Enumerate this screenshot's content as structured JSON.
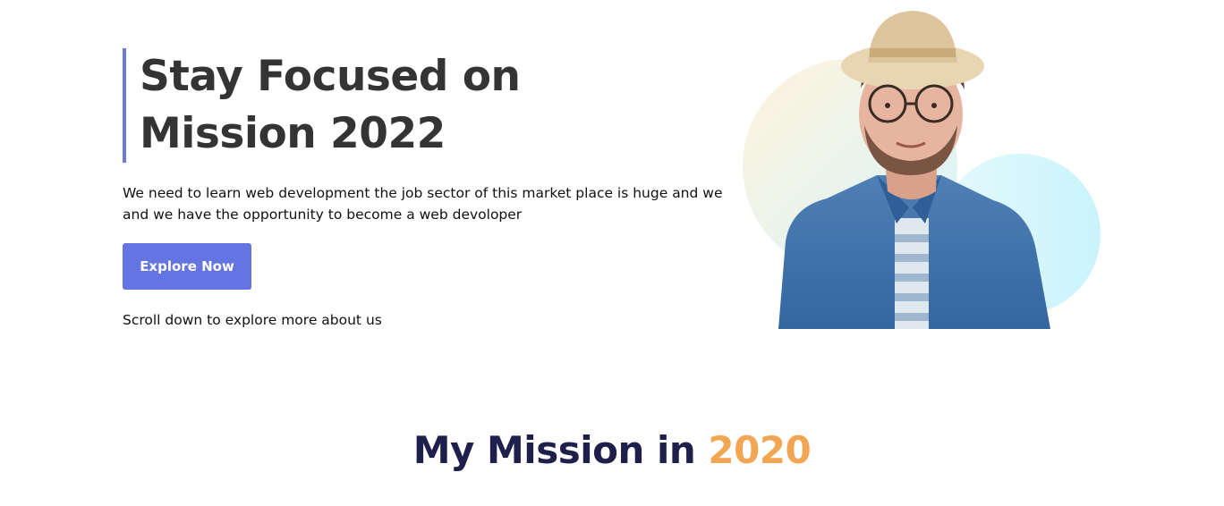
{
  "hero": {
    "title": "Stay Focused on Mission 2022",
    "description": "We need to learn web development the job sector of this market place is huge and we and we have the opportunity to become a web devoloper",
    "button_label": "Explore Now",
    "scroll_hint": "Scroll down to explore more about us",
    "portrait_icon": "person-illustration"
  },
  "mission": {
    "heading_prefix": "My Mission in ",
    "heading_year": "2020"
  },
  "colors": {
    "title": "#343434",
    "accent_bar": "#6b7bd9",
    "button": "#6474e0",
    "heading": "#1e1f4b",
    "year": "#f2a654"
  }
}
